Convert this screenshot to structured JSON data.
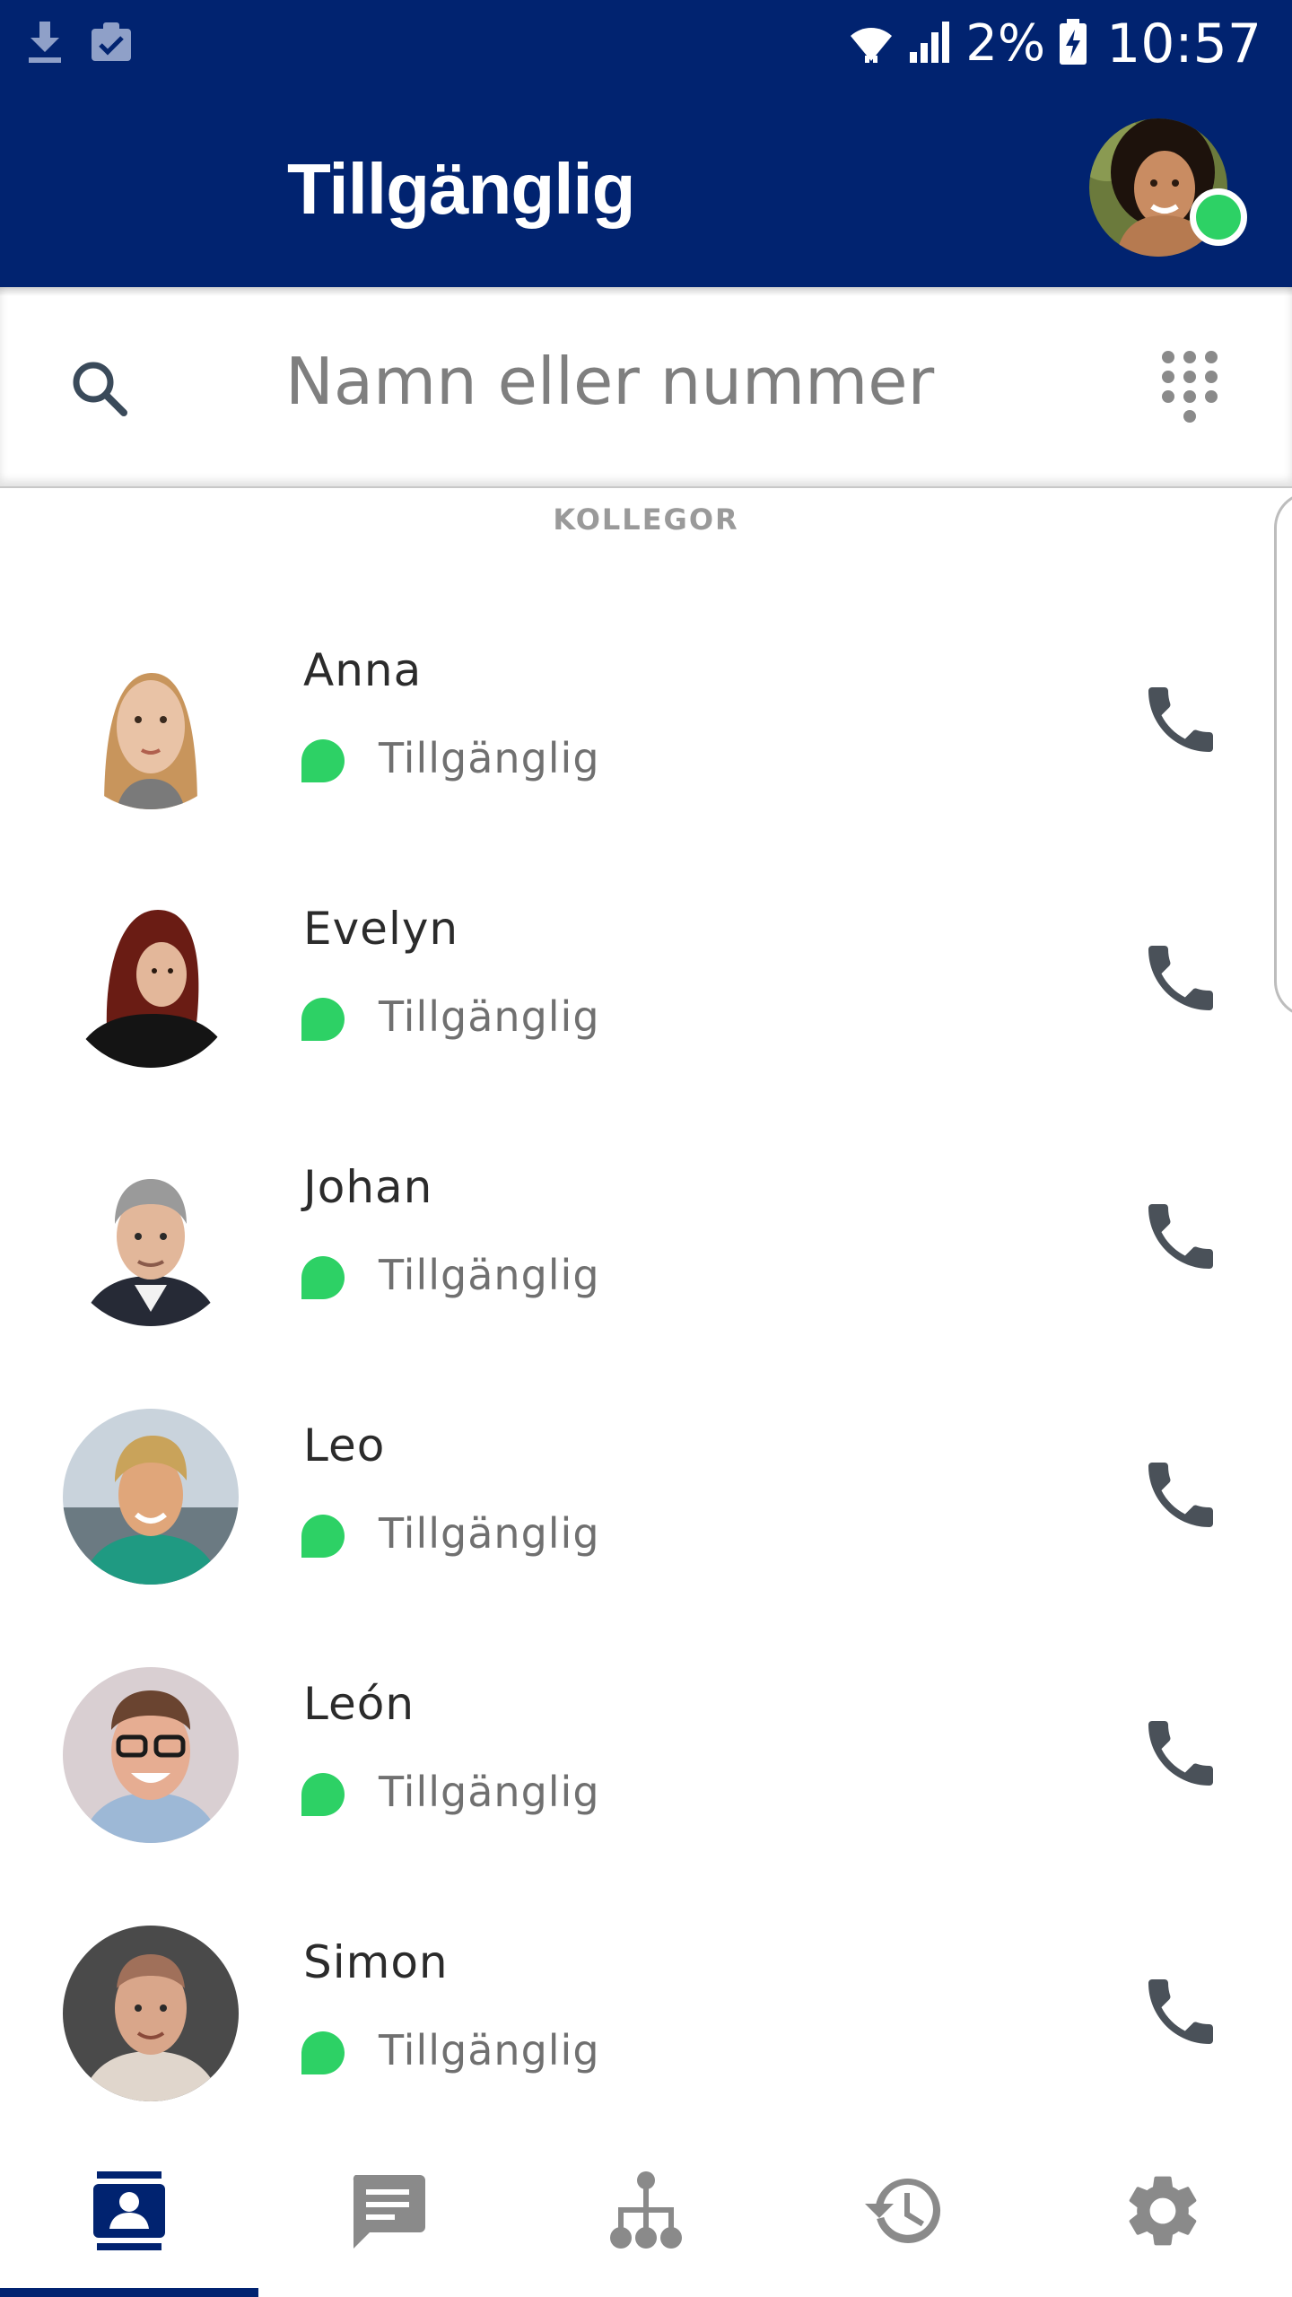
{
  "status_bar": {
    "battery_percent": "2%",
    "time": "10:57"
  },
  "app_bar": {
    "title": "Tillgänglig",
    "user_status_color": "#2dd165"
  },
  "search": {
    "placeholder": "Namn eller nummer",
    "value": ""
  },
  "section": {
    "label": "KOLLEGOR"
  },
  "contacts": [
    {
      "name": "Anna",
      "status": "Tillgänglig"
    },
    {
      "name": "Evelyn",
      "status": "Tillgänglig"
    },
    {
      "name": "Johan",
      "status": "Tillgänglig"
    },
    {
      "name": "Leo",
      "status": "Tillgänglig"
    },
    {
      "name": "León",
      "status": "Tillgänglig"
    },
    {
      "name": "Simon",
      "status": "Tillgänglig"
    }
  ],
  "bottom_nav": {
    "items": [
      "contacts-icon",
      "chat-icon",
      "org-chart-icon",
      "history-icon",
      "settings-icon"
    ],
    "active": "contacts-icon"
  },
  "colors": {
    "brand": "#012370",
    "available": "#2dd165",
    "icon_gray": "#8a8a8a",
    "call_icon": "#4a5159"
  }
}
